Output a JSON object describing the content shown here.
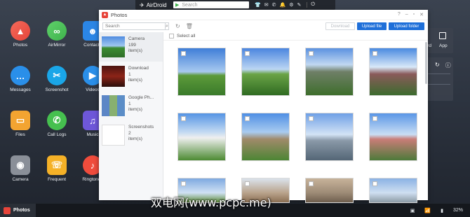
{
  "topbar": {
    "brand": "AirDroid",
    "search_placeholder": "Search"
  },
  "desktop": {
    "icons": [
      {
        "label": "Photos"
      },
      {
        "label": "AirMirror"
      },
      {
        "label": "Contacts"
      },
      {
        "label": "Messages"
      },
      {
        "label": "Screenshot"
      },
      {
        "label": "Videos"
      },
      {
        "label": "Files"
      },
      {
        "label": "Call Logs"
      },
      {
        "label": "Music"
      },
      {
        "label": "Camera"
      },
      {
        "label": "Frequent"
      },
      {
        "label": "Ringtones"
      }
    ],
    "right_panel": {
      "keyboard_label": "oard",
      "app_label": "App"
    }
  },
  "window": {
    "title": "Photos",
    "search_placeholder": "Search",
    "download_label": "Download",
    "upload_file_label": "Upload file",
    "upload_folder_label": "Upload folder",
    "select_all_label": "Select all",
    "albums": [
      {
        "name": "Camera",
        "count": "199",
        "unit": "item(s)"
      },
      {
        "name": "Download",
        "count": "1",
        "unit": "item(s)"
      },
      {
        "name": "Google Ph...",
        "count": "1",
        "unit": "item(s)"
      },
      {
        "name": "Screenshots",
        "count": "2",
        "unit": "item(s)"
      }
    ]
  },
  "taskbar": {
    "active_app": "Photos",
    "battery": "32%"
  },
  "watermark": "双电网(www.pcpc.me)"
}
